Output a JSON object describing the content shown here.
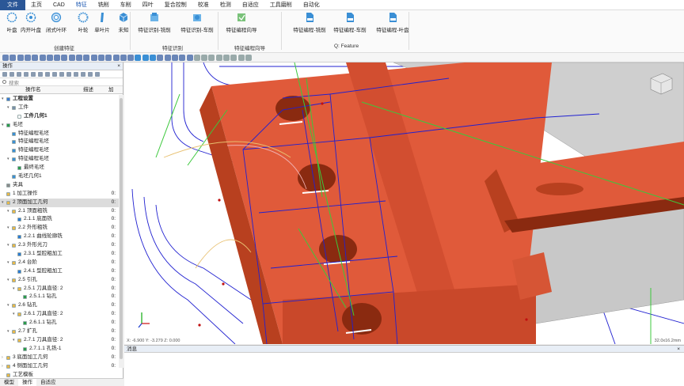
{
  "menu": [
    "文件",
    "主页",
    "CAD",
    "特征",
    "铣削",
    "车削",
    "四叶",
    "复合控制",
    "校准",
    "检测",
    "自适应",
    "工具磨削",
    "自动化"
  ],
  "ribbon": {
    "buttons": [
      {
        "label": "叶盘",
        "icon": "blade-disk-icon"
      },
      {
        "label": "内开叶盘",
        "icon": "inner-blade-disk-icon"
      },
      {
        "label": "闭式叶环",
        "icon": "closed-ring-icon"
      },
      {
        "label": "叶轮",
        "icon": "impeller-icon"
      },
      {
        "label": "单叶片",
        "icon": "single-blade-icon"
      },
      {
        "label": "未知",
        "icon": "unknown-cube-icon"
      },
      {
        "label": "特征识别-铣削",
        "icon": "feature-mill-icon"
      },
      {
        "label": "特征识别-车削",
        "icon": "feature-turn-icon"
      },
      {
        "label": "特征编程向导",
        "icon": "wizard-icon"
      },
      {
        "label": "特征编程-铣削",
        "icon": "api-mill-icon"
      },
      {
        "label": "特征编程-车削",
        "icon": "api-turn-icon"
      },
      {
        "label": "特征编程-叶盘",
        "icon": "api-blade-icon"
      }
    ],
    "groups": [
      "创建特征",
      "特征识别",
      "特征编程向导",
      "Q: Feature"
    ]
  },
  "panel": {
    "title": "操作",
    "close": "×",
    "search_placeholder": "搜索",
    "columns": [
      "操作名",
      "描述",
      "加"
    ]
  },
  "tree": [
    {
      "label": "工程设置",
      "level": 0,
      "toggle": "▾",
      "icon": "project-icon",
      "color": "#3a7bd5",
      "bold": true,
      "val": ""
    },
    {
      "label": "工件",
      "level": 1,
      "toggle": "▾",
      "icon": "workpiece-icon",
      "color": "#7a8fa8",
      "val": ""
    },
    {
      "label": "工件几何1",
      "level": 2,
      "toggle": "",
      "icon": "geometry-icon",
      "color": "#ffffff",
      "bold": true,
      "val": ""
    },
    {
      "label": "毛坯",
      "level": 0,
      "toggle": "▾",
      "icon": "stock-icon",
      "color": "#2a9d4a",
      "val": ""
    },
    {
      "label": "特征编程毛坯",
      "level": 1,
      "toggle": "",
      "icon": "stock-item-icon",
      "color": "#3a8fd5",
      "val": ""
    },
    {
      "label": "特征编程毛坯",
      "level": 1,
      "toggle": "",
      "icon": "stock-item-icon",
      "color": "#3a8fd5",
      "val": ""
    },
    {
      "label": "特征编程毛坯",
      "level": 1,
      "toggle": "",
      "icon": "stock-item-icon",
      "color": "#3a8fd5",
      "val": ""
    },
    {
      "label": "特征编程毛坯",
      "level": 1,
      "toggle": "▾",
      "icon": "stock-item-icon",
      "color": "#3a8fd5",
      "val": ""
    },
    {
      "label": "最终毛坯",
      "level": 2,
      "toggle": "",
      "icon": "final-stock-icon",
      "color": "#2a9d4a",
      "val": ""
    },
    {
      "label": "毛坯几何1",
      "level": 1,
      "toggle": "",
      "icon": "stock-geometry-icon",
      "color": "#3a8fd5",
      "val": ""
    },
    {
      "label": "夹具",
      "level": 0,
      "toggle": "",
      "icon": "fixture-icon",
      "color": "#8a8a8a",
      "val": ""
    },
    {
      "label": "1 加工操作",
      "level": 0,
      "toggle": "",
      "icon": "folder-icon",
      "color": "#e8b84a",
      "val": "0:"
    },
    {
      "label": "2 顶面加工几何",
      "level": 0,
      "toggle": "▾",
      "icon": "folder-icon",
      "color": "#e8b84a",
      "val": "0:",
      "selected": true
    },
    {
      "label": "2.1 顶面粗铣",
      "level": 1,
      "toggle": "▾",
      "icon": "folder-icon",
      "color": "#e8b84a",
      "val": "0:"
    },
    {
      "label": "2.1.1 底面铣",
      "level": 2,
      "toggle": "",
      "icon": "op-icon",
      "color": "#2a7bd5",
      "val": "0:"
    },
    {
      "label": "2.2 外形粗铣",
      "level": 1,
      "toggle": "▾",
      "icon": "folder-icon",
      "color": "#e8b84a",
      "val": "0:"
    },
    {
      "label": "2.2.1 曲线轮廓铣",
      "level": 2,
      "toggle": "",
      "icon": "op-icon",
      "color": "#2a7bd5",
      "val": "0:"
    },
    {
      "label": "2.3 外形光刀",
      "level": 1,
      "toggle": "▾",
      "icon": "folder-icon",
      "color": "#e8b84a",
      "val": "0:"
    },
    {
      "label": "2.3.1 型腔粗加工",
      "level": 2,
      "toggle": "",
      "icon": "op-icon",
      "color": "#2a7bd5",
      "val": "0:"
    },
    {
      "label": "2.4 台阶",
      "level": 1,
      "toggle": "▾",
      "icon": "folder-icon",
      "color": "#e8b84a",
      "val": "0:"
    },
    {
      "label": "2.4.1 型腔粗加工",
      "level": 2,
      "toggle": "",
      "icon": "op-icon",
      "color": "#2a7bd5",
      "val": "0:"
    },
    {
      "label": "2.5 引孔",
      "level": 1,
      "toggle": "▾",
      "icon": "folder-icon",
      "color": "#e8b84a",
      "val": "0:"
    },
    {
      "label": "2.5.1 刀具直径: 2",
      "level": 2,
      "toggle": "▾",
      "icon": "folder-icon",
      "color": "#e8b84a",
      "val": "0:"
    },
    {
      "label": "2.5.1.1 钻孔",
      "level": 3,
      "toggle": "",
      "icon": "drill-icon",
      "color": "#2a9d4a",
      "val": "0:"
    },
    {
      "label": "2.6 钻孔",
      "level": 1,
      "toggle": "▾",
      "icon": "folder-icon",
      "color": "#e8b84a",
      "val": "0:"
    },
    {
      "label": "2.6.1 刀具直径: 2",
      "level": 2,
      "toggle": "▾",
      "icon": "folder-icon",
      "color": "#e8b84a",
      "val": "0:"
    },
    {
      "label": "2.6.1.1 钻孔",
      "level": 3,
      "toggle": "",
      "icon": "drill-icon",
      "color": "#2a9d4a",
      "val": "0:"
    },
    {
      "label": "2.7 扩孔",
      "level": 1,
      "toggle": "▾",
      "icon": "folder-icon",
      "color": "#e8b84a",
      "val": "0:"
    },
    {
      "label": "2.7.1 刀具直径: 2",
      "level": 2,
      "toggle": "▾",
      "icon": "folder-icon",
      "color": "#e8b84a",
      "val": "0:"
    },
    {
      "label": "2.7.1.1 孔铣-1",
      "level": 3,
      "toggle": "",
      "icon": "drill-icon",
      "color": "#2a9d4a",
      "val": "0:"
    },
    {
      "label": "3 底面加工几何",
      "level": 0,
      "toggle": "›",
      "icon": "folder-icon",
      "color": "#e8b84a",
      "val": "0:"
    },
    {
      "label": "4 侧面加工几何",
      "level": 0,
      "toggle": "›",
      "icon": "folder-icon",
      "color": "#e8b84a",
      "val": "0:"
    },
    {
      "label": "工艺模板",
      "level": 0,
      "toggle": "",
      "icon": "template-icon",
      "color": "#e8b84a",
      "val": ""
    }
  ],
  "bottom_tabs": [
    "模型",
    "操作",
    "自适应"
  ],
  "viewport": {
    "coords": "X: -6.900  Y: -3.279  Z: 0.000",
    "scale": "32.0x16.2mm",
    "colors": {
      "part": "#e05a3a",
      "part_dark": "#b8401f",
      "toolpath": "#2020d0",
      "line_green": "#3cc83c",
      "hole": "#8a2a10"
    }
  },
  "messages": {
    "title": "消息",
    "close": "×"
  }
}
